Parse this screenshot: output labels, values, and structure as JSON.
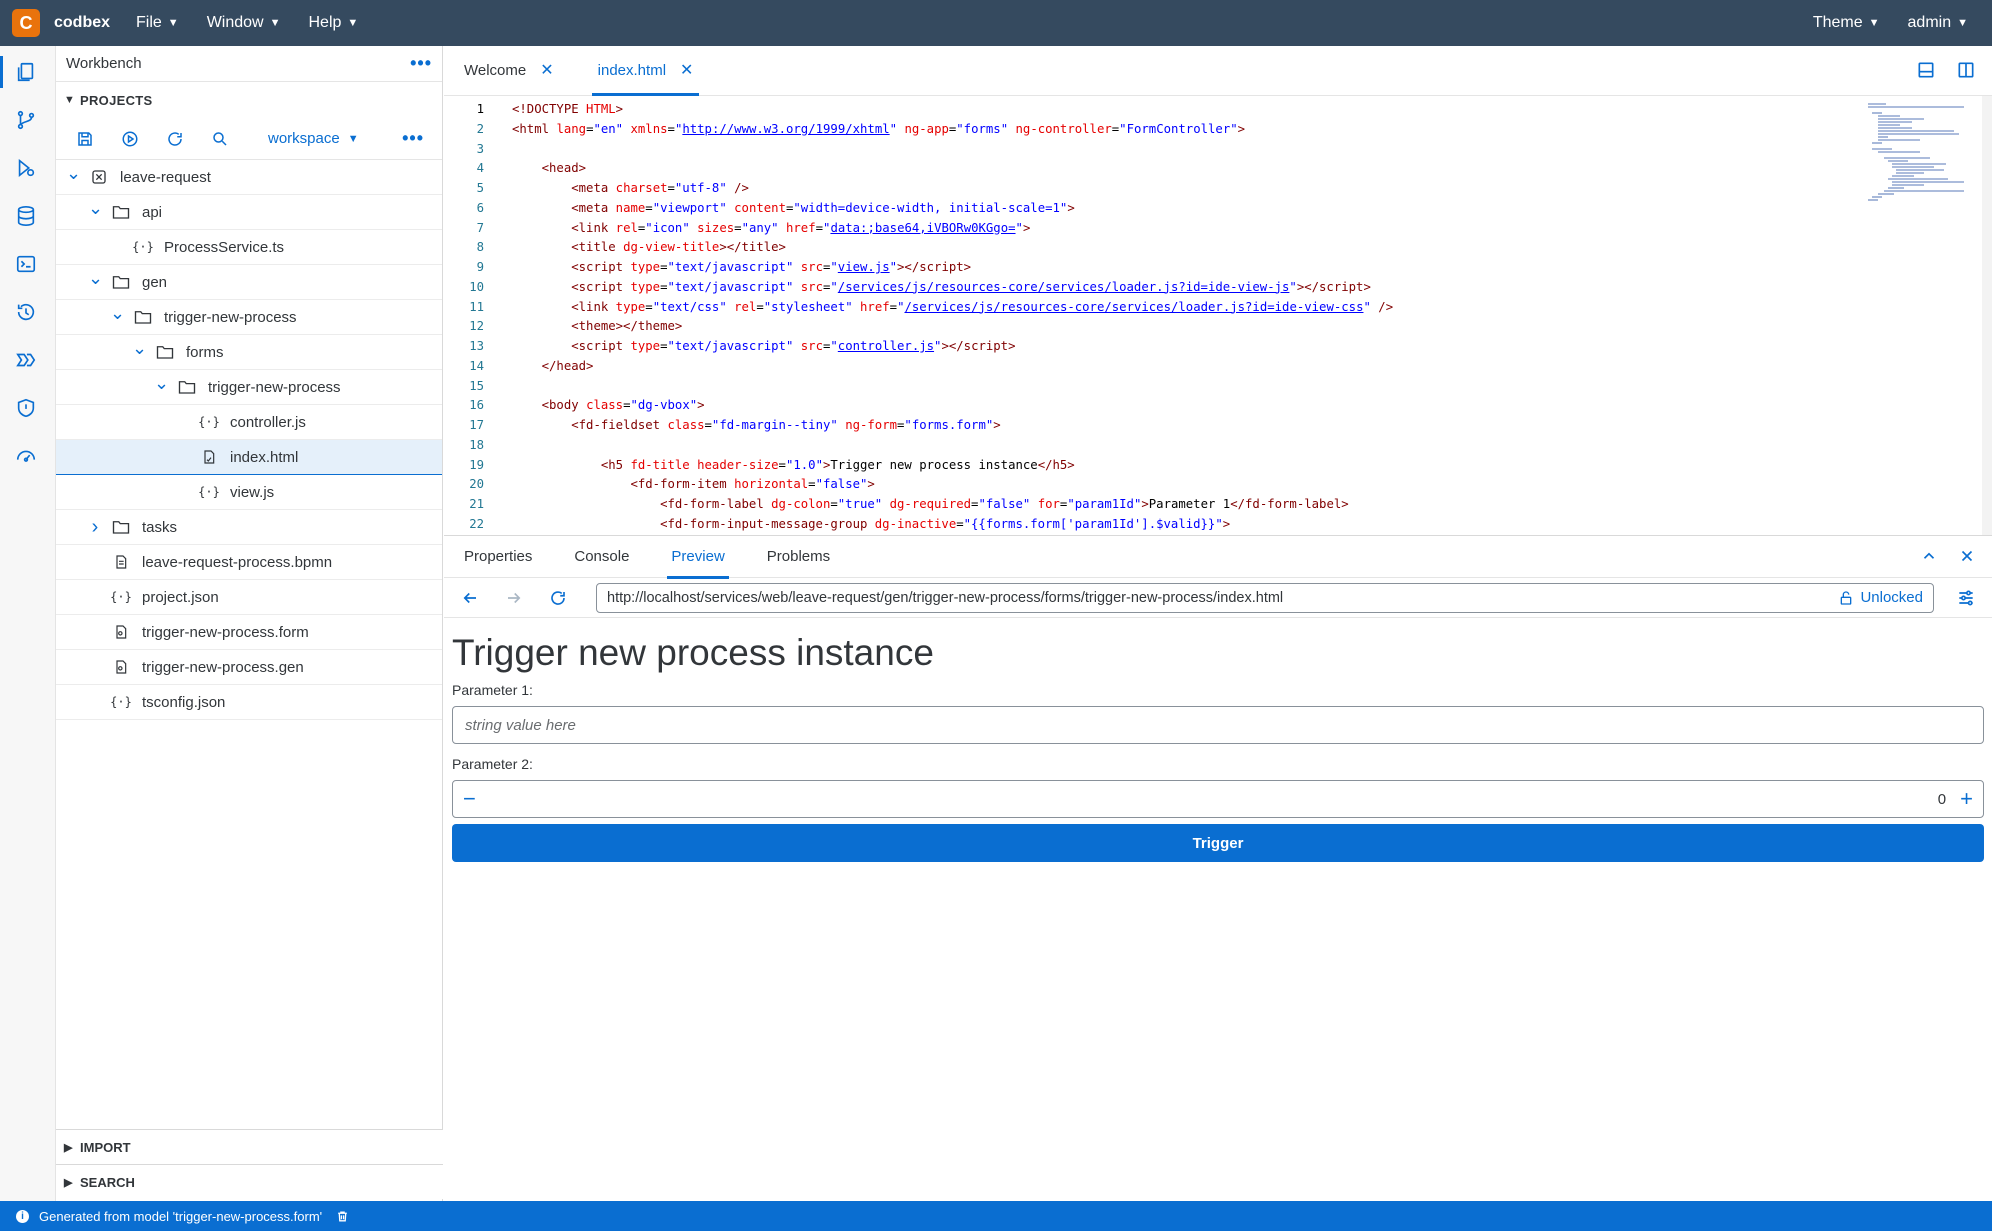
{
  "app": {
    "name": "codbex",
    "logo_letter": "C"
  },
  "menu": [
    {
      "label": "File"
    },
    {
      "label": "Window"
    },
    {
      "label": "Help"
    }
  ],
  "topright": {
    "theme": "Theme",
    "user": "admin"
  },
  "sidebar": {
    "title": "Workbench",
    "projects_label": "PROJECTS",
    "workspace_label": "workspace",
    "import_label": "IMPORT",
    "search_label": "SEARCH",
    "tree": [
      {
        "label": "leave-request",
        "type": "project",
        "depth": 0,
        "expanded": true
      },
      {
        "label": "api",
        "type": "folder",
        "depth": 1,
        "expanded": true
      },
      {
        "label": "ProcessService.ts",
        "type": "code",
        "depth": 2
      },
      {
        "label": "gen",
        "type": "folder",
        "depth": 1,
        "expanded": true
      },
      {
        "label": "trigger-new-process",
        "type": "folder",
        "depth": 2,
        "expanded": true
      },
      {
        "label": "forms",
        "type": "folder",
        "depth": 3,
        "expanded": true
      },
      {
        "label": "trigger-new-process",
        "type": "folder",
        "depth": 4,
        "expanded": true
      },
      {
        "label": "controller.js",
        "type": "code",
        "depth": 5
      },
      {
        "label": "index.html",
        "type": "html",
        "depth": 5,
        "selected": true
      },
      {
        "label": "view.js",
        "type": "code",
        "depth": 5
      },
      {
        "label": "tasks",
        "type": "folder",
        "depth": 1,
        "expanded": false
      },
      {
        "label": "leave-request-process.bpmn",
        "type": "doc",
        "depth": 1
      },
      {
        "label": "project.json",
        "type": "code",
        "depth": 1
      },
      {
        "label": "trigger-new-process.form",
        "type": "form",
        "depth": 1
      },
      {
        "label": "trigger-new-process.gen",
        "type": "form",
        "depth": 1
      },
      {
        "label": "tsconfig.json",
        "type": "code",
        "depth": 1
      }
    ]
  },
  "editor": {
    "tabs": [
      {
        "label": "Welcome",
        "active": false
      },
      {
        "label": "index.html",
        "active": true
      }
    ]
  },
  "code_lines": [
    {
      "n": "1",
      "h": "<span class='d'>&lt;!DOCTYPE </span><span class='a'>HTML</span><span class='d'>&gt;</span>"
    },
    {
      "n": "2",
      "h": "<span class='t'>&lt;html</span> <span class='a'>lang</span>=<span class='s'>\"en\"</span> <span class='a'>xmlns</span>=<span class='s'>\"</span><span class='u'>http://www.w3.org/1999/xhtml</span><span class='s'>\"</span> <span class='a'>ng-app</span>=<span class='s'>\"forms\"</span> <span class='a'>ng-controller</span>=<span class='s'>\"FormController\"</span><span class='t'>&gt;</span>"
    },
    {
      "n": "3",
      "h": ""
    },
    {
      "n": "4",
      "h": "    <span class='t'>&lt;head&gt;</span>"
    },
    {
      "n": "5",
      "h": "        <span class='t'>&lt;meta</span> <span class='a'>charset</span>=<span class='s'>\"utf-8\"</span> <span class='t'>/&gt;</span>"
    },
    {
      "n": "6",
      "h": "        <span class='t'>&lt;meta</span> <span class='a'>name</span>=<span class='s'>\"viewport\"</span> <span class='a'>content</span>=<span class='s'>\"width=device-width, initial-scale=1\"</span><span class='t'>&gt;</span>"
    },
    {
      "n": "7",
      "h": "        <span class='t'>&lt;link</span> <span class='a'>rel</span>=<span class='s'>\"icon\"</span> <span class='a'>sizes</span>=<span class='s'>\"any\"</span> <span class='a'>href</span>=<span class='s'>\"</span><span class='u'>data:;base64,iVBORw0KGgo=</span><span class='s'>\"</span><span class='t'>&gt;</span>"
    },
    {
      "n": "8",
      "h": "        <span class='t'>&lt;title</span> <span class='a'>dg-view-title</span><span class='t'>&gt;&lt;/title&gt;</span>"
    },
    {
      "n": "9",
      "h": "        <span class='t'>&lt;script</span> <span class='a'>type</span>=<span class='s'>\"text/javascript\"</span> <span class='a'>src</span>=<span class='s'>\"</span><span class='u'>view.js</span><span class='s'>\"</span><span class='t'>&gt;&lt;/script&gt;</span>"
    },
    {
      "n": "10",
      "h": "        <span class='t'>&lt;script</span> <span class='a'>type</span>=<span class='s'>\"text/javascript\"</span> <span class='a'>src</span>=<span class='s'>\"</span><span class='u'>/services/js/resources-core/services/loader.js?id=ide-view-js</span><span class='s'>\"</span><span class='t'>&gt;&lt;/script&gt;</span>"
    },
    {
      "n": "11",
      "h": "        <span class='t'>&lt;link</span> <span class='a'>type</span>=<span class='s'>\"text/css\"</span> <span class='a'>rel</span>=<span class='s'>\"stylesheet\"</span> <span class='a'>href</span>=<span class='s'>\"</span><span class='u'>/services/js/resources-core/services/loader.js?id=ide-view-css</span><span class='s'>\"</span> <span class='t'>/&gt;</span>"
    },
    {
      "n": "12",
      "h": "        <span class='t'>&lt;theme&gt;&lt;/theme&gt;</span>"
    },
    {
      "n": "13",
      "h": "        <span class='t'>&lt;script</span> <span class='a'>type</span>=<span class='s'>\"text/javascript\"</span> <span class='a'>src</span>=<span class='s'>\"</span><span class='u'>controller.js</span><span class='s'>\"</span><span class='t'>&gt;&lt;/script&gt;</span>"
    },
    {
      "n": "14",
      "h": "    <span class='t'>&lt;/head&gt;</span>"
    },
    {
      "n": "15",
      "h": ""
    },
    {
      "n": "16",
      "h": "    <span class='t'>&lt;body</span> <span class='a'>class</span>=<span class='s'>\"dg-vbox\"</span><span class='t'>&gt;</span>"
    },
    {
      "n": "17",
      "h": "        <span class='t'>&lt;fd-fieldset</span> <span class='a'>class</span>=<span class='s'>\"fd-margin--tiny\"</span> <span class='a'>ng-form</span>=<span class='s'>\"forms.form\"</span><span class='t'>&gt;</span>"
    },
    {
      "n": "18",
      "h": ""
    },
    {
      "n": "19",
      "h": "            <span class='t'>&lt;h5</span> <span class='a'>fd-title</span> <span class='a'>header-size</span>=<span class='s'>\"1.0\"</span><span class='t'>&gt;</span>Trigger new process instance<span class='t'>&lt;/h5&gt;</span>"
    },
    {
      "n": "20",
      "h": "                <span class='t'>&lt;fd-form-item</span> <span class='a'>horizontal</span>=<span class='s'>\"false\"</span><span class='t'>&gt;</span>"
    },
    {
      "n": "21",
      "h": "                    <span class='t'>&lt;fd-form-label</span> <span class='a'>dg-colon</span>=<span class='s'>\"true\"</span> <span class='a'>dg-required</span>=<span class='s'>\"false\"</span> <span class='a'>for</span>=<span class='s'>\"param1Id\"</span><span class='t'>&gt;</span>Parameter 1<span class='t'>&lt;/fd-form-label&gt;</span>"
    },
    {
      "n": "22",
      "h": "                    <span class='t'>&lt;fd-form-input-message-group</span> <span class='a'>dg-inactive</span>=<span class='s'>\"{{forms.form['param1Id'].$valid}}\"</span><span class='t'>&gt;</span>"
    }
  ],
  "panel": {
    "tabs": [
      {
        "label": "Properties"
      },
      {
        "label": "Console"
      },
      {
        "label": "Preview",
        "active": true
      },
      {
        "label": "Problems"
      }
    ],
    "url": "http://localhost/services/web/leave-request/gen/trigger-new-process/forms/trigger-new-process/index.html",
    "lock_label": "Unlocked"
  },
  "preview": {
    "title": "Trigger new process instance",
    "param1_label": "Parameter 1:",
    "param1_placeholder": "string value here",
    "param2_label": "Parameter 2:",
    "param2_value": "0",
    "button": "Trigger"
  },
  "status": {
    "message": "Generated from model 'trigger-new-process.form'"
  },
  "colors": {
    "shell": "#354a5f",
    "accent": "#0a6ed1",
    "logo": "#e9730c"
  }
}
